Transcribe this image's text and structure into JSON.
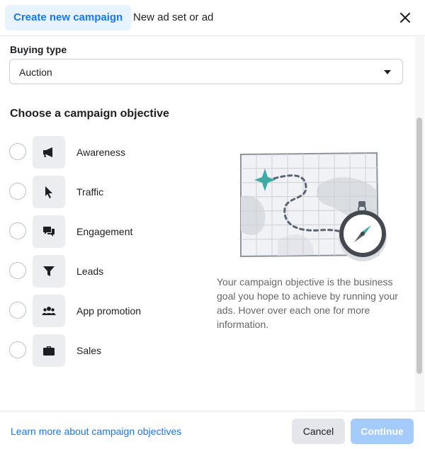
{
  "header": {
    "tabs": [
      {
        "label": "Create new campaign",
        "active": true
      },
      {
        "label": "New ad set or ad",
        "active": false
      }
    ],
    "close_icon": "close-icon"
  },
  "buying_type": {
    "label": "Buying type",
    "value": "Auction"
  },
  "objectives": {
    "title": "Choose a campaign objective",
    "items": [
      {
        "label": "Awareness",
        "icon": "megaphone-icon"
      },
      {
        "label": "Traffic",
        "icon": "cursor-icon"
      },
      {
        "label": "Engagement",
        "icon": "chat-bubbles-icon"
      },
      {
        "label": "Leads",
        "icon": "funnel-icon"
      },
      {
        "label": "App promotion",
        "icon": "people-icon"
      },
      {
        "label": "Sales",
        "icon": "briefcase-icon"
      }
    ]
  },
  "info": {
    "description": "Your campaign objective is the business goal you hope to achieve by running your ads. Hover over each one for more information."
  },
  "footer": {
    "learn_more": "Learn more about campaign objectives",
    "cancel": "Cancel",
    "continue": "Continue"
  },
  "colors": {
    "accent": "#1877f2",
    "accent_light": "#e7f3ff",
    "continue_disabled": "#a4cbf9",
    "teal_marker": "#3fa9a3"
  }
}
